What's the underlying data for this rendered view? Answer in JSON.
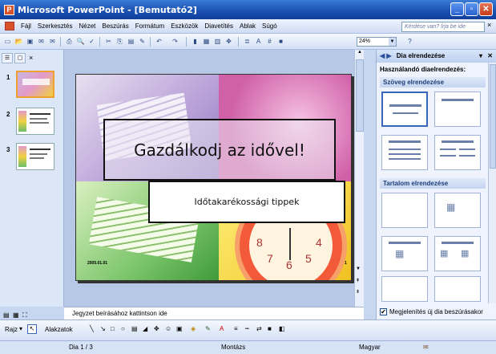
{
  "window": {
    "title": "Microsoft PowerPoint - [Bemutató2]",
    "app_icon": "powerpoint-icon",
    "minimize": "_",
    "maximize": "▫",
    "close": "✕"
  },
  "menu": {
    "items": [
      "Fájl",
      "Szerkesztés",
      "Nézet",
      "Beszúrás",
      "Formátum",
      "Eszközök",
      "Diavetítés",
      "Ablak",
      "Súgó"
    ],
    "help_placeholder": "Kérdése van? Írja be ide",
    "close_doc": "×"
  },
  "toolbar": {
    "zoom": "24%"
  },
  "left_pane": {
    "tab_close": "×",
    "slides": [
      {
        "number": "1",
        "selected": true
      },
      {
        "number": "2",
        "selected": false
      },
      {
        "number": "3",
        "selected": false
      }
    ]
  },
  "slide": {
    "title": "Gazdálkodj  az idővel!",
    "subtitle": "Időtakarékossági tippek",
    "footer": "2005.01.01",
    "page_number": "1",
    "clock_numbers": [
      "8",
      "7",
      "6",
      "5",
      "4"
    ]
  },
  "notes": {
    "placeholder": "Jegyzet beírásához kattintson ide"
  },
  "task_pane": {
    "title": "Dia elrendezése",
    "subtitle": "Használandó diaelrendezés:",
    "section_text": "Szöveg elrendezése",
    "section_content": "Tartalom elrendezése",
    "checkbox_label": "Megjelenítés új dia beszúrásakor",
    "checkbox_checked": "✔"
  },
  "drawing_toolbar": {
    "draw_label": "Rajz",
    "autoshapes_label": "Alakzatok"
  },
  "status": {
    "slide_position": "Dia 1 / 3",
    "design": "Montázs",
    "language": "Magyar"
  },
  "colors": {
    "titlebar": "#1a4fb0",
    "selection": "#f0a030"
  }
}
